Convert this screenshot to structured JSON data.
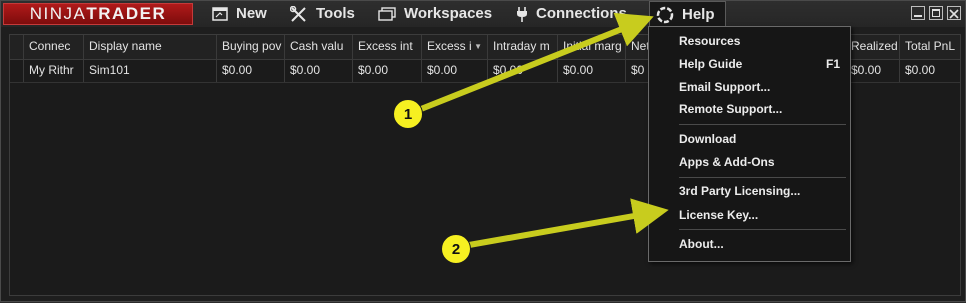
{
  "logo": {
    "part1": "NINJA",
    "part2": "TRADER"
  },
  "menu": {
    "new_label": "New",
    "tools_label": "Tools",
    "workspaces_label": "Workspaces",
    "connections_label": "Connections",
    "help_label": "Help"
  },
  "grid": {
    "columns": [
      "Connec",
      "Display name",
      "Buying pov",
      "Cash valu",
      "Excess int",
      "Excess i",
      "Intraday m",
      "Initial marg",
      "Net",
      "",
      "Realized",
      "Total PnL"
    ],
    "rows": [
      [
        "My Rithr",
        "Sim101",
        "$0.00",
        "$0.00",
        "$0.00",
        "$0.00",
        "$0.00",
        "$0.00",
        "$0",
        "",
        "$0.00",
        "$0.00"
      ]
    ]
  },
  "help_menu": {
    "items": [
      {
        "label": "Resources",
        "shortcut": ""
      },
      {
        "label": "Help Guide",
        "shortcut": "F1"
      },
      {
        "label": "Email Support...",
        "shortcut": ""
      },
      {
        "label": "Remote Support...",
        "shortcut": ""
      },
      {
        "label": "Download",
        "shortcut": ""
      },
      {
        "label": "Apps & Add-Ons",
        "shortcut": ""
      },
      {
        "label": "3rd Party Licensing...",
        "shortcut": ""
      },
      {
        "label": "License Key...",
        "shortcut": ""
      },
      {
        "label": "About...",
        "shortcut": ""
      }
    ]
  },
  "callouts": [
    "1",
    "2"
  ],
  "colors": {
    "accent": "#b01a1a",
    "callout": "#f6f021",
    "arrow": "#c8cc1e"
  }
}
